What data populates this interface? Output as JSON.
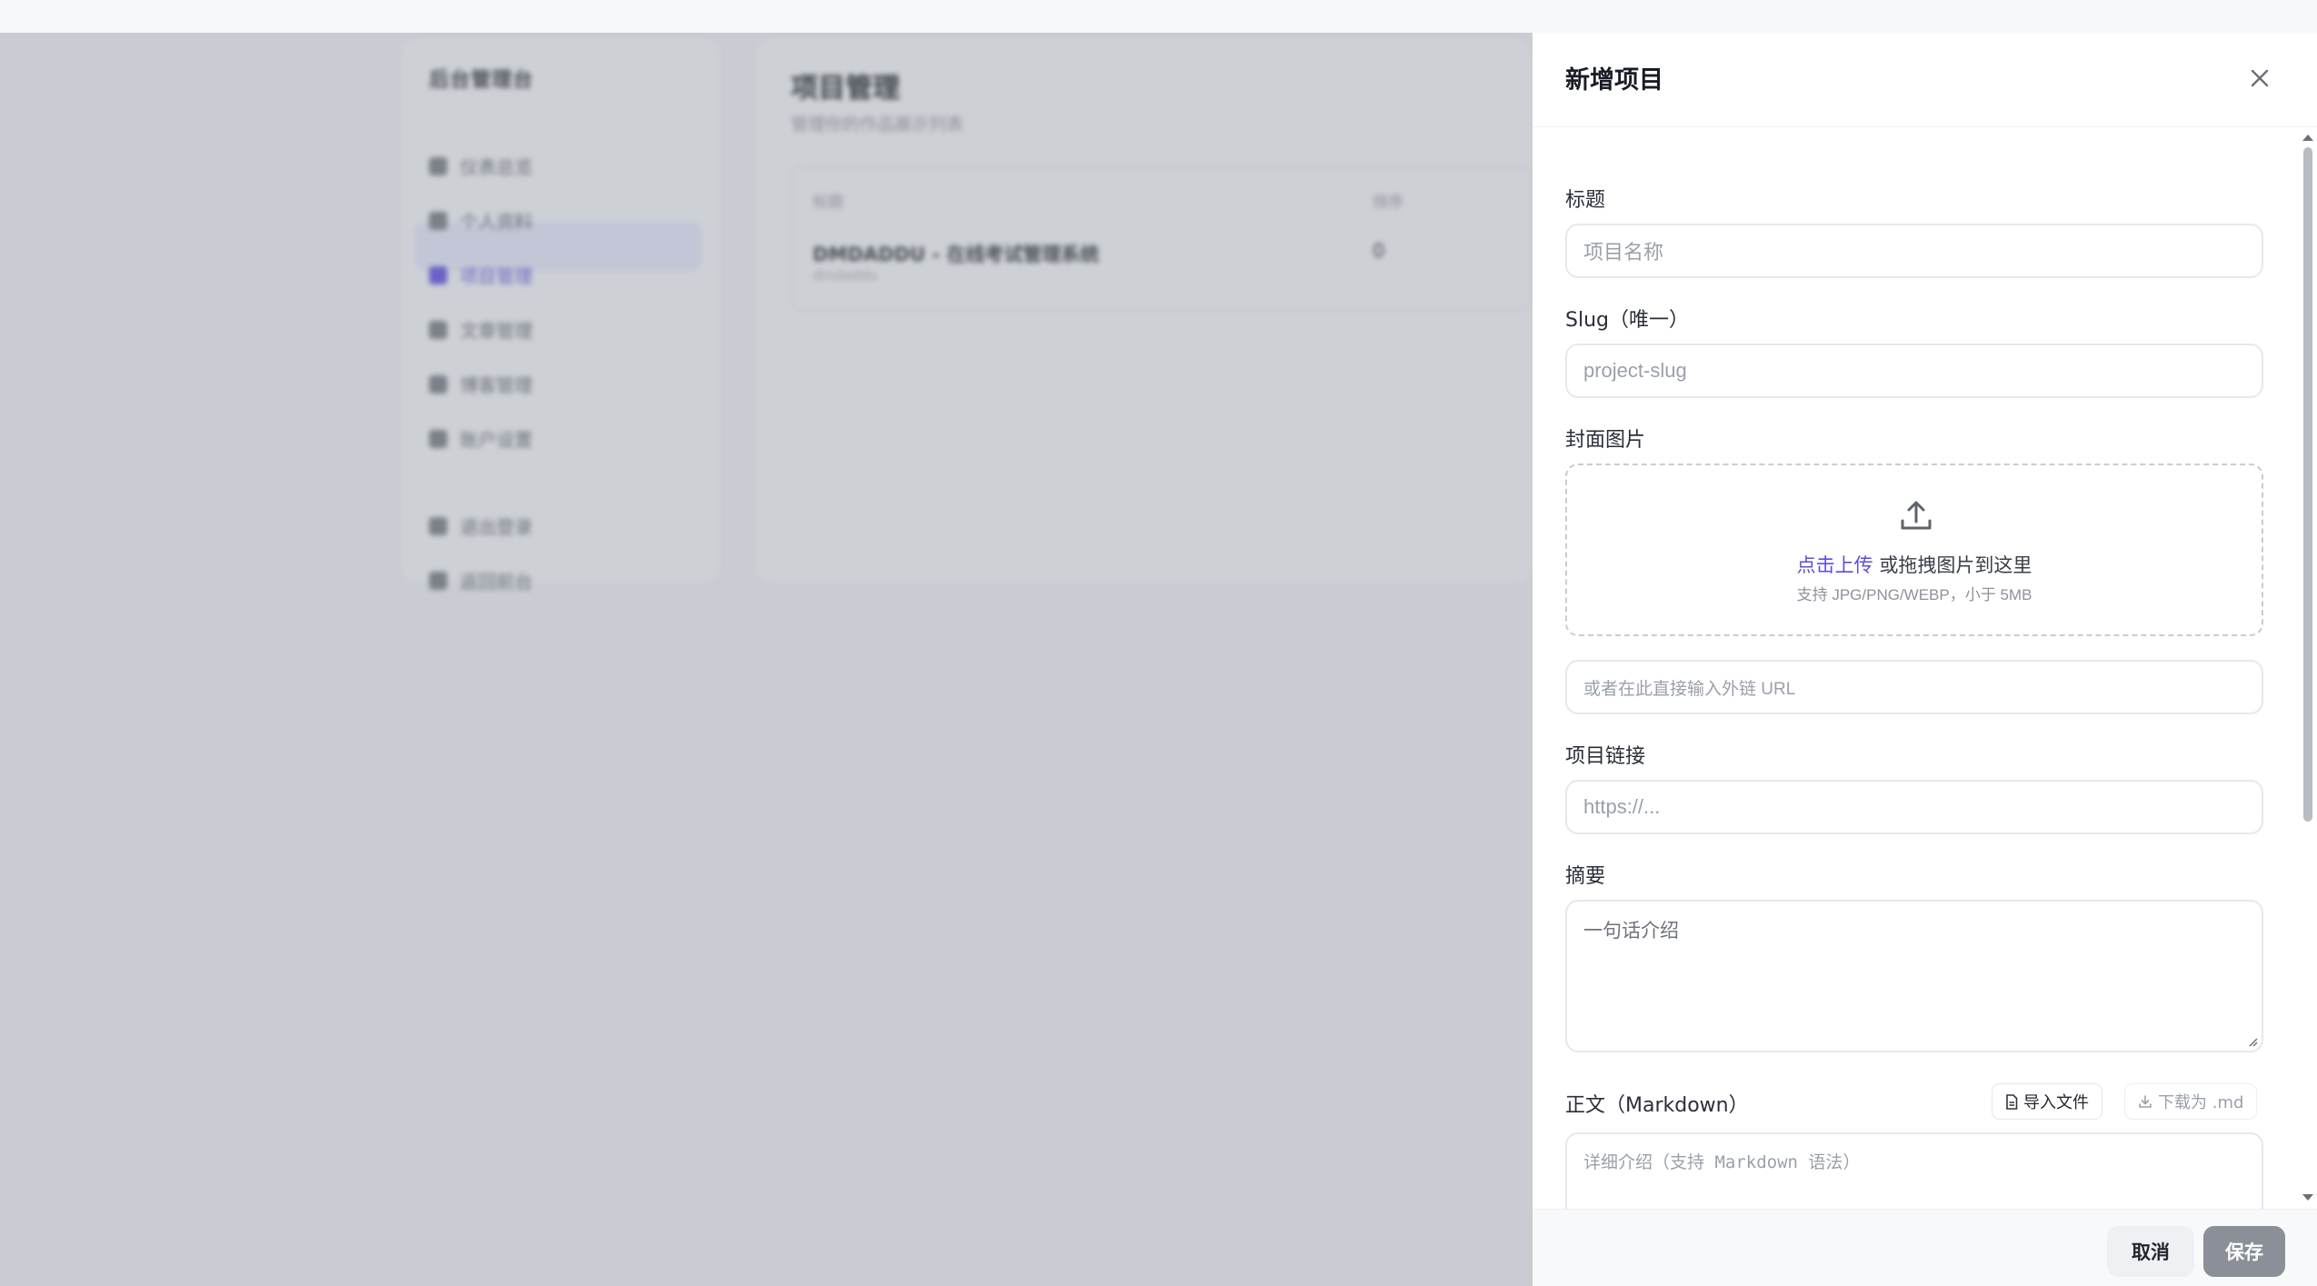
{
  "background": {
    "sidebar": {
      "brand": "后台管理台",
      "items": [
        {
          "label": "仪表总览",
          "active": false
        },
        {
          "label": "个人资料",
          "active": false
        },
        {
          "label": "项目管理",
          "active": true
        },
        {
          "label": "文章管理",
          "active": false
        },
        {
          "label": "博客管理",
          "active": false
        },
        {
          "label": "账户设置",
          "active": false
        },
        {
          "label": "退出登录",
          "active": false
        },
        {
          "label": "返回前台",
          "active": false
        }
      ]
    },
    "main": {
      "title": "项目管理",
      "subtitle": "管理你的作品展示列表",
      "table": {
        "headers": [
          "标题",
          "排序"
        ],
        "rows": [
          {
            "title": "DMDADDU - 在线考试管理系统",
            "slug": "dmdaddu",
            "order": "0"
          }
        ]
      }
    }
  },
  "drawer": {
    "title": "新增项目",
    "fields": {
      "title": {
        "label": "标题",
        "placeholder": "项目名称"
      },
      "slug": {
        "label": "Slug（唯一）",
        "placeholder": "project-slug"
      },
      "cover": {
        "label": "封面图片",
        "upload_link": "点击上传",
        "upload_text": " 或拖拽图片到这里",
        "upload_hint": "支持 JPG/PNG/WEBP，小于 5MB",
        "url_placeholder": "或者在此直接输入外链 URL"
      },
      "link": {
        "label": "项目链接",
        "placeholder": "https://..."
      },
      "summary": {
        "label": "摘要",
        "placeholder": "一句话介绍"
      },
      "body": {
        "label": "正文（Markdown）",
        "import_label": "导入文件",
        "download_label": "下载为 .md",
        "placeholder": "详细介绍（支持 Markdown 语法）"
      }
    },
    "footer": {
      "cancel_label": "取消",
      "save_label": "保存"
    }
  },
  "colors": {
    "accent": "#5b4fd6",
    "overlay": "#c9ccd2",
    "save_disabled": "#8a8f98"
  }
}
